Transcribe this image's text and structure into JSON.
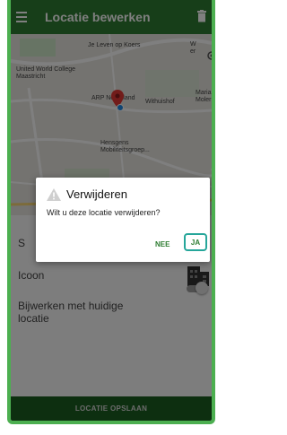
{
  "app_bar": {
    "title": "Locatie bewerken"
  },
  "map": {
    "labels": {
      "koers": "Je Leven op Koers",
      "world_college": "United World College Maastricht",
      "arp": "ARP Nederland",
      "withuishof": "Withuishof",
      "hensgens": "Hensgens Mobiliteitsgroep...",
      "maria": "Maria Moler",
      "w_partial": "W er"
    }
  },
  "form": {
    "icoon_label": "Icoon",
    "update_label": "Bijwerken met huidige locatie",
    "s_partial": "S"
  },
  "save_button": "LOCATIE OPSLAAN",
  "dialog": {
    "title": "Verwijderen",
    "message": "Wilt u deze locatie verwijderen?",
    "no": "NEE",
    "yes": "JA"
  },
  "colors": {
    "primary": "#2e7d32",
    "accent_border": "#4caf50",
    "yes_outline": "#26a69a"
  }
}
